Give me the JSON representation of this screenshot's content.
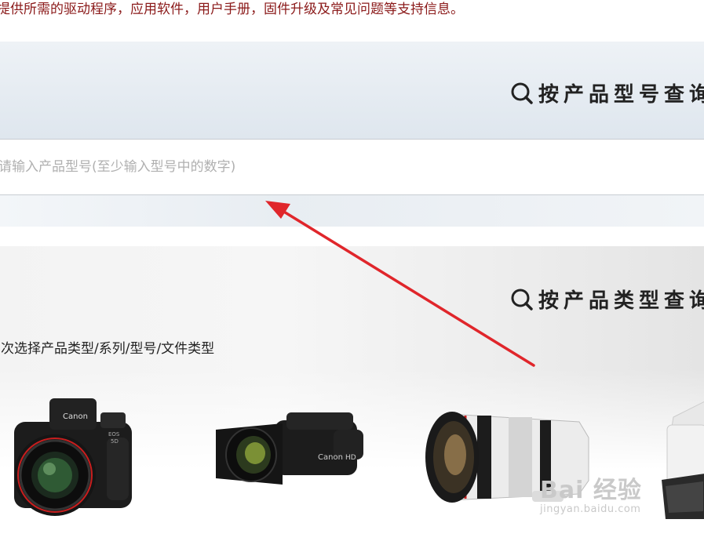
{
  "intro_text": "提供所需的驱动程序，应用软件，用户手册，固件升级及常见问题等支持信息。",
  "model_search": {
    "title": "按产品型号查询",
    "placeholder": "请输入产品型号(至少输入型号中的数字)"
  },
  "type_search": {
    "title": "按产品类型查询",
    "hint": "次选择产品类型/系列/型号/文件类型"
  },
  "products": [
    {
      "name": "camera",
      "brand": "Canon"
    },
    {
      "name": "camcorder",
      "brand": "Canon"
    },
    {
      "name": "lens",
      "brand": ""
    },
    {
      "name": "printer",
      "brand": ""
    }
  ],
  "watermark": {
    "main": "Bai 经验",
    "sub": "jingyan.baidu.com"
  },
  "colors": {
    "intro": "#8b1a1a",
    "arrow": "#e0262b",
    "panel": "#e2e9f0"
  },
  "icons": {
    "search": "search-icon",
    "arrow": "red-arrow-annotation"
  }
}
